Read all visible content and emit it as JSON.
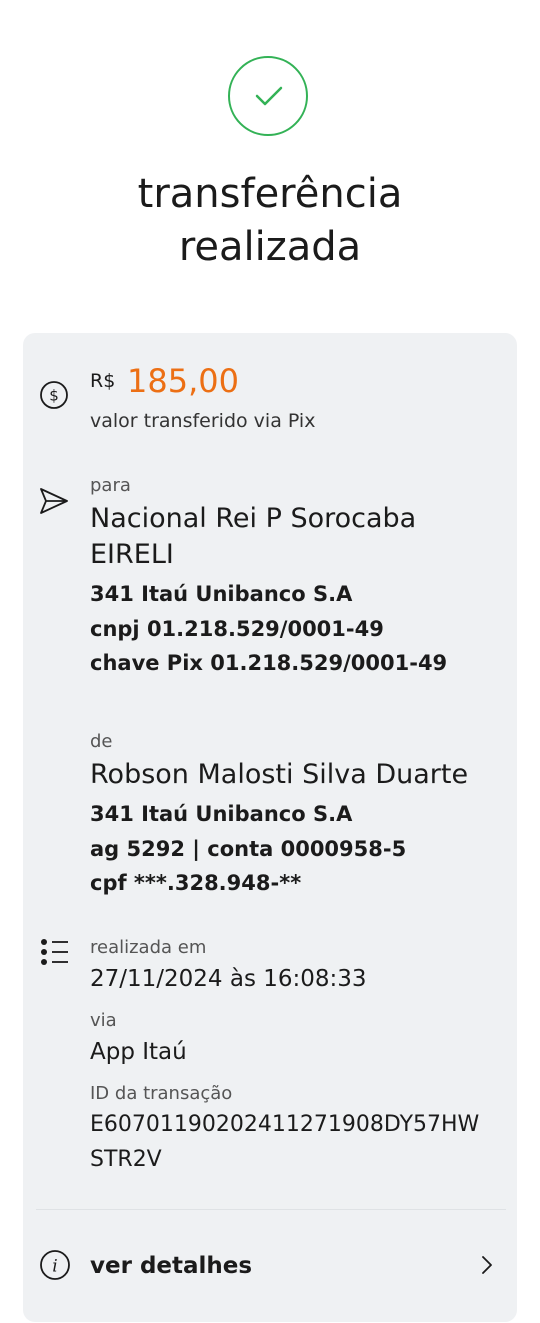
{
  "header": {
    "title_line1": "transferência",
    "title_line2": "realizada"
  },
  "amount": {
    "currency": "R$",
    "value": "185,00",
    "caption": "valor transferido via Pix"
  },
  "recipient": {
    "label": "para",
    "name_line1": "Nacional Rei P Sorocaba",
    "name_line2": "EIRELI",
    "bank": "341 Itaú Unibanco S.A",
    "cnpj": "cnpj 01.218.529/0001-49",
    "pix_key": "chave Pix 01.218.529/0001-49"
  },
  "sender": {
    "label": "de",
    "name": "Robson Malosti Silva Duarte",
    "bank": "341 Itaú Unibanco S.A",
    "account": "ag 5292 | conta 0000958-5",
    "cpf": "cpf ***.328.948-**"
  },
  "info": {
    "date_label": "realizada em",
    "date_value": "27/11/2024 às 16:08:33",
    "via_label": "via",
    "via_value": "App Itaú",
    "id_label": "ID da transação",
    "id_line1": "E60701190202411271908DY57HW",
    "id_line2": "STR2V"
  },
  "details": {
    "label": "ver detalhes"
  },
  "icons": {
    "success": "check-icon",
    "amount": "dollar-circle-icon",
    "recipient": "send-icon",
    "info": "list-icon",
    "details": "info-icon",
    "chevron": "chevron-right-icon"
  },
  "colors": {
    "success": "#33b256",
    "accent_amount": "#ec6f14",
    "card_bg": "#eff1f3",
    "text": "#1b1b1b"
  }
}
